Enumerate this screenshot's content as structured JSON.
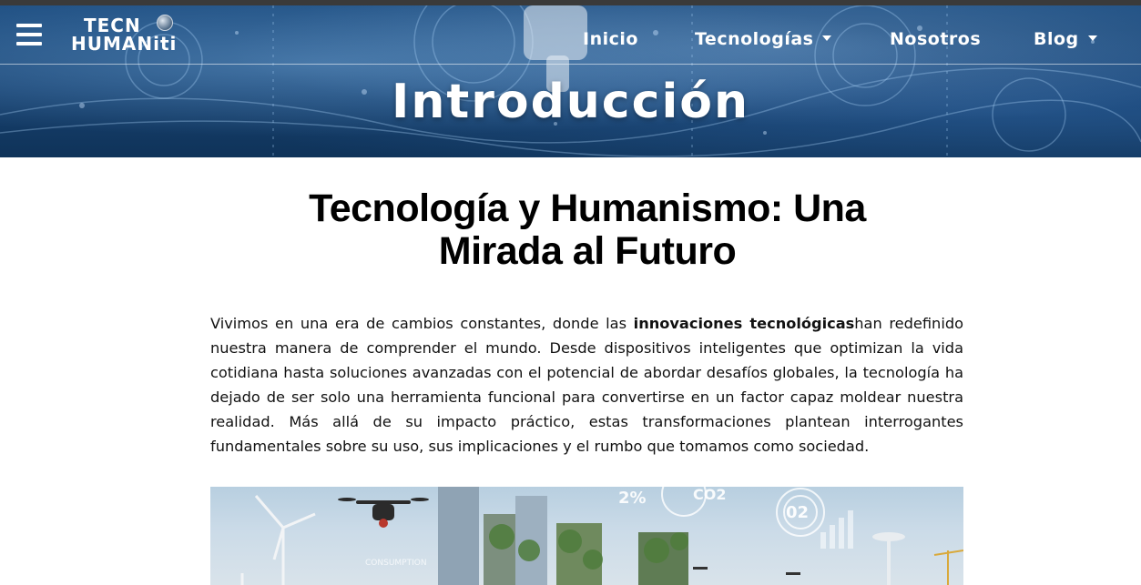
{
  "brand": {
    "logo_line1": "TECN",
    "logo_line2": "HUMANiti",
    "logo_icon": "globe-icon"
  },
  "nav": {
    "menu_icon": "hamburger-menu-icon",
    "items": [
      {
        "label": "Inicio",
        "has_dropdown": false
      },
      {
        "label": "Tecnologías",
        "has_dropdown": true
      },
      {
        "label": "Nosotros",
        "has_dropdown": false
      },
      {
        "label": "Blog",
        "has_dropdown": true
      }
    ]
  },
  "hero": {
    "title": "Introducción"
  },
  "article": {
    "title": "Tecnología y Humanismo: Una Mirada al Futuro",
    "intro": {
      "before_bold": "Vivimos en una era de cambios constantes, donde las ",
      "bold": "innovaciones tecnológicas",
      "after_bold": "han redefinido nuestra manera de comprender el mundo. Desde dispositivos inteligentes que optimizan la vida cotidiana hasta soluciones avanzadas con el potencial de abordar desafíos globales, la tecnología ha dejado de ser solo una herramienta funcional para convertirse en un factor capaz moldear nuestra realidad. Más allá de su impacto práctico, estas transformaciones plantean interrogantes fundamentales sobre su uso, sus implicaciones y el rumbo que tomamos como sociedad."
    },
    "image": {
      "overlay_texts": [
        "2%",
        "CO2",
        "02",
        "CONSUMPTION"
      ]
    }
  },
  "colors": {
    "hero_bg": "#174170",
    "nav_text": "#ffffff",
    "body_text": "#111111"
  }
}
